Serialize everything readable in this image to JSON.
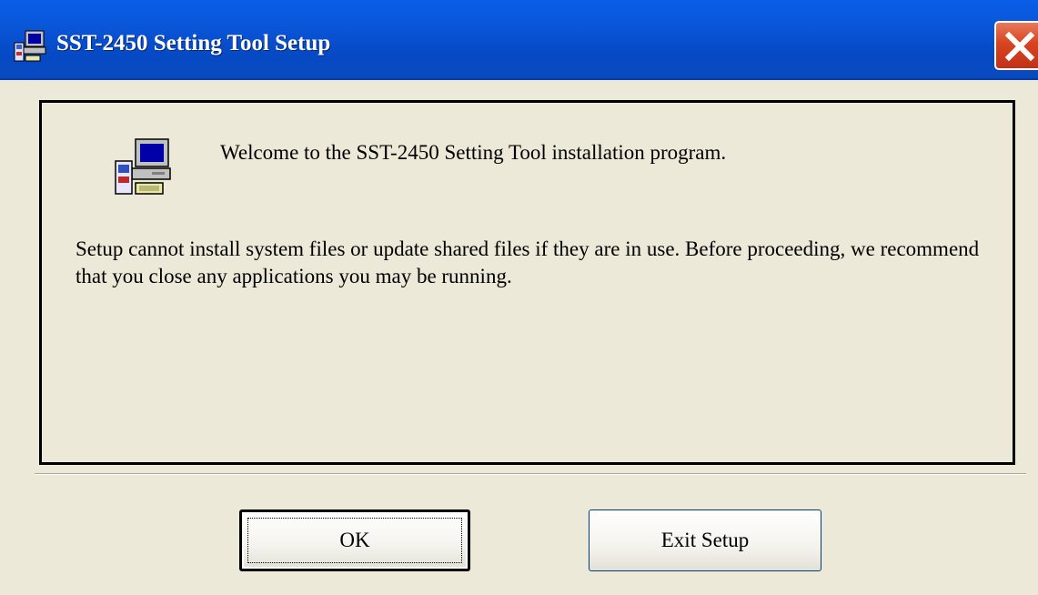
{
  "window": {
    "title": "SST-2450 Setting Tool Setup",
    "title_icon": "setup-computer-icon",
    "close_icon": "close-icon"
  },
  "content": {
    "icon": "setup-computer-icon",
    "welcome_text": "Welcome to the SST-2450 Setting Tool installation program.",
    "note_text": "Setup cannot install system files or update shared files if they are in use. Before proceeding, we recommend that you close any applications you may be running."
  },
  "buttons": {
    "ok_label": "OK",
    "exit_label": "Exit Setup"
  },
  "colors": {
    "titlebar": "#0a55d8",
    "close_button": "#d84420",
    "dialog_background": "#ece9d8"
  }
}
